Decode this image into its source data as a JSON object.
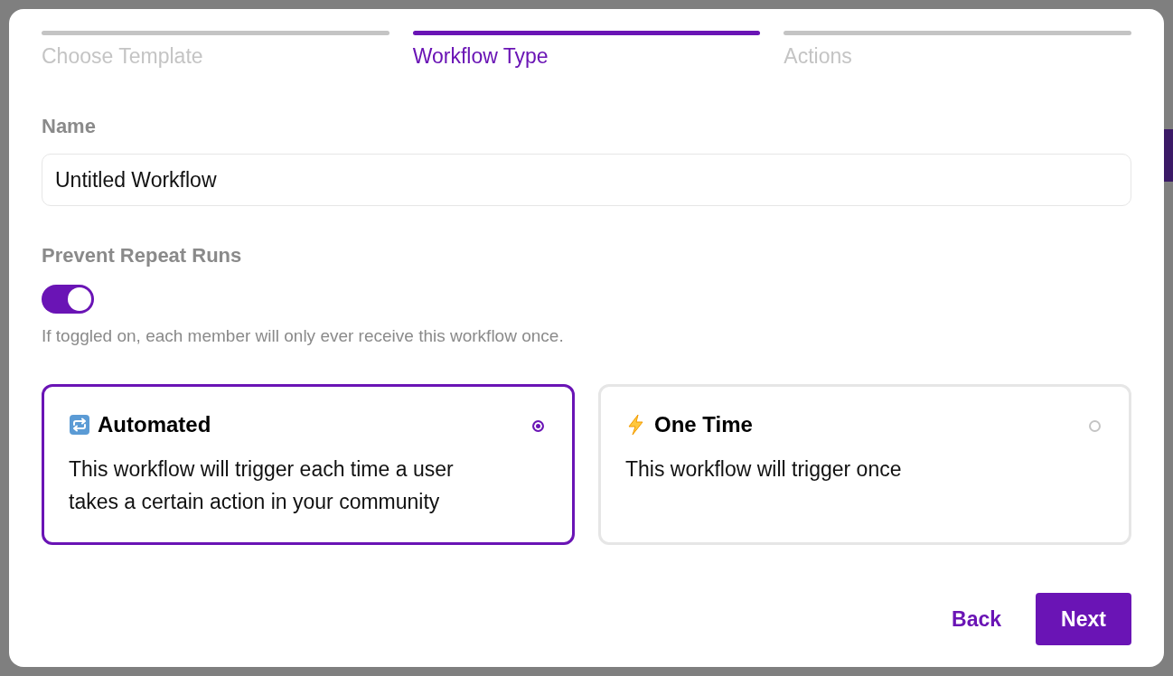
{
  "steps": [
    {
      "label": "Choose Template",
      "selected": false
    },
    {
      "label": "Workflow Type",
      "selected": true
    },
    {
      "label": "Actions",
      "selected": false
    }
  ],
  "name_field": {
    "label": "Name",
    "value": "Untitled Workflow"
  },
  "prevent_repeat": {
    "label": "Prevent Repeat Runs",
    "on": true,
    "hint": "If toggled on, each member will only ever receive this workflow once."
  },
  "workflow_types": [
    {
      "kind": "automated",
      "title": "Automated",
      "description": "This workflow will trigger each time a user takes a certain action in your community",
      "selected": true
    },
    {
      "kind": "one_time",
      "title": "One Time",
      "description": "This workflow will trigger once",
      "selected": false
    }
  ],
  "buttons": [
    {
      "label": "Back",
      "kind": "secondary"
    },
    {
      "label": "Next",
      "kind": "primary"
    }
  ]
}
